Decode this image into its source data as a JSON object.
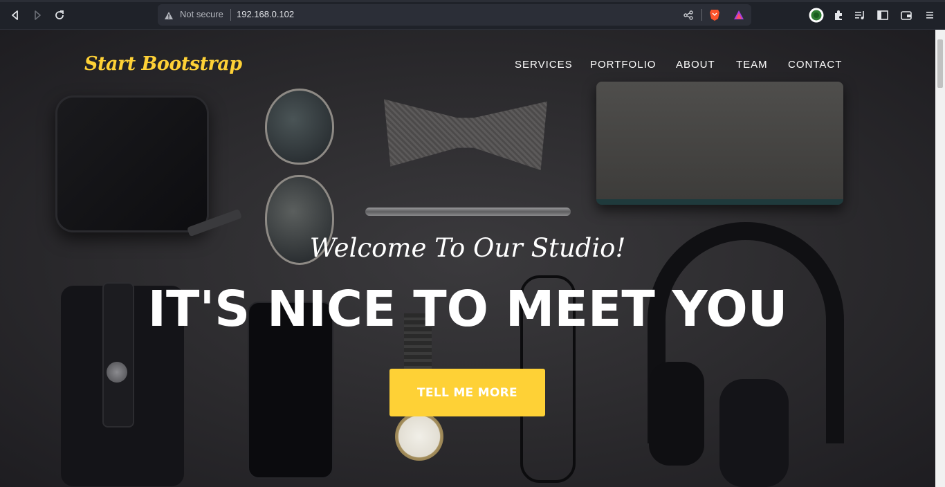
{
  "browser": {
    "security_label": "Not secure",
    "url": "192.168.0.102",
    "icons": {
      "back": "back-icon",
      "forward": "forward-icon",
      "reload": "reload-icon",
      "warning": "warning-icon",
      "share": "share-icon",
      "brave_shields": "brave-shields-icon",
      "brave_rewards": "brave-rewards-icon",
      "profile": "profile-icon",
      "extensions": "extensions-icon",
      "playlist": "playlist-icon",
      "sidebar": "sidebar-icon",
      "wallet": "wallet-icon",
      "menu": "menu-icon"
    }
  },
  "site": {
    "brand": "Start Bootstrap",
    "nav": {
      "services": "SERVICES",
      "portfolio": "PORTFOLIO",
      "about": "ABOUT",
      "team": "TEAM",
      "contact": "CONTACT"
    },
    "hero": {
      "subheading": "Welcome To Our Studio!",
      "heading": "IT'S NICE TO MEET YOU",
      "button": "TELL ME MORE"
    },
    "colors": {
      "accent": "#fed136",
      "text": "#ffffff"
    }
  }
}
